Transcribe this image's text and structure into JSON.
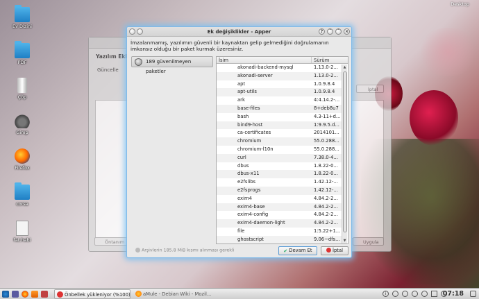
{
  "desktop": {
    "button_label": "Desktop",
    "icons": [
      {
        "label": "Ev Dizini",
        "icon": "home-folder-icon"
      },
      {
        "label": "PDF",
        "icon": "folder-icon"
      },
      {
        "label": "Çöp",
        "icon": "trash-icon"
      },
      {
        "label": "Gimp",
        "icon": "gimp-icon"
      },
      {
        "label": "Firefox",
        "icon": "firefox-icon"
      },
      {
        "label": "corsa",
        "icon": "folder-icon"
      },
      {
        "label": "fat.habi",
        "icon": "document-icon"
      }
    ]
  },
  "background_window": {
    "title": "Yazılım Ekle",
    "subtitle": "Güncelle",
    "cancel_label": "İptal",
    "left_button": "Öntanım",
    "right_button": "Uygula"
  },
  "dialog": {
    "title": "Ek değişiklikler - Apper",
    "message": "İmzalanmamış, yazılımın güvenli bir kaynaktan gelip gelmediğini doğrulamanın imkansız olduğu bir paket kurmak üzeresiniz.",
    "sidebar_item": "189 güvenilmeyen paketler",
    "columns": {
      "name": "İsim",
      "version": "Sürüm"
    },
    "packages": [
      {
        "name": "akonadi-backend-mysql",
        "version": "1.13.0-2..."
      },
      {
        "name": "akonadi-server",
        "version": "1.13.0-2..."
      },
      {
        "name": "apt",
        "version": "1.0.9.8.4"
      },
      {
        "name": "apt-utils",
        "version": "1.0.9.8.4"
      },
      {
        "name": "ark",
        "version": "4:4.14.2-..."
      },
      {
        "name": "base-files",
        "version": "8+deb8u7"
      },
      {
        "name": "bash",
        "version": "4.3-11+d..."
      },
      {
        "name": "bind9-host",
        "version": "1:9.9.5.d..."
      },
      {
        "name": "ca-certificates",
        "version": "2014101..."
      },
      {
        "name": "chromium",
        "version": "55.0.288..."
      },
      {
        "name": "chromium-l10n",
        "version": "55.0.288..."
      },
      {
        "name": "curl",
        "version": "7.38.0-4..."
      },
      {
        "name": "dbus",
        "version": "1.8.22-0..."
      },
      {
        "name": "dbus-x11",
        "version": "1.8.22-0..."
      },
      {
        "name": "e2fslibs",
        "version": "1.42.12-..."
      },
      {
        "name": "e2fsprogs",
        "version": "1.42.12-..."
      },
      {
        "name": "exim4",
        "version": "4.84.2-2..."
      },
      {
        "name": "exim4-base",
        "version": "4.84.2-2..."
      },
      {
        "name": "exim4-config",
        "version": "4.84.2-2..."
      },
      {
        "name": "exim4-daemon-light",
        "version": "4.84.2-2..."
      },
      {
        "name": "file",
        "version": "1:5.22+1..."
      },
      {
        "name": "ghostscript",
        "version": "9.06~dfs..."
      }
    ],
    "footnote": "Arşivlerin 185.8 MiB kısmı alınması gerekli",
    "continue_label": "Devam Et",
    "cancel_label": "İptal"
  },
  "taskbar": {
    "tasks": [
      {
        "label": "Önbellek yükleniyor (%100)",
        "active": true
      },
      {
        "label": "aMule - Debian Wiki - Mozil...",
        "active": false
      }
    ],
    "clock": "07:18"
  }
}
